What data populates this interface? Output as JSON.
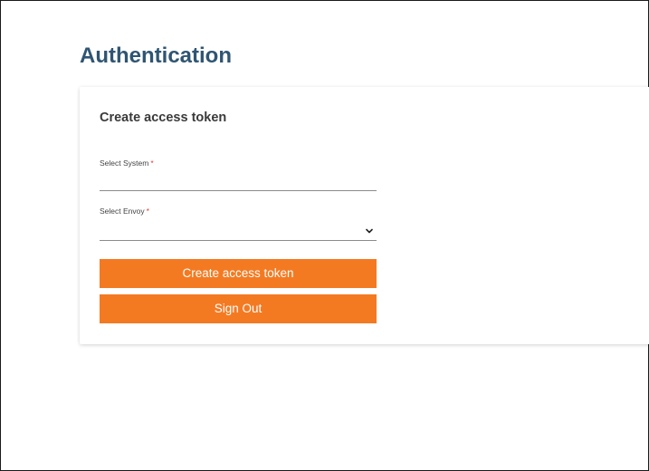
{
  "page": {
    "title": "Authentication"
  },
  "card": {
    "title": "Create access token",
    "fields": {
      "system": {
        "label": "Select System",
        "required_mark": "*",
        "value": ""
      },
      "envoy": {
        "label": "Select Envoy",
        "required_mark": "*",
        "value": "",
        "icon": "chevron-down-icon"
      }
    },
    "buttons": {
      "create_label": "Create access token",
      "signout_label": "Sign Out"
    }
  },
  "colors": {
    "title": "#2f5573",
    "accent": "#f47a22",
    "required": "#e53935"
  }
}
